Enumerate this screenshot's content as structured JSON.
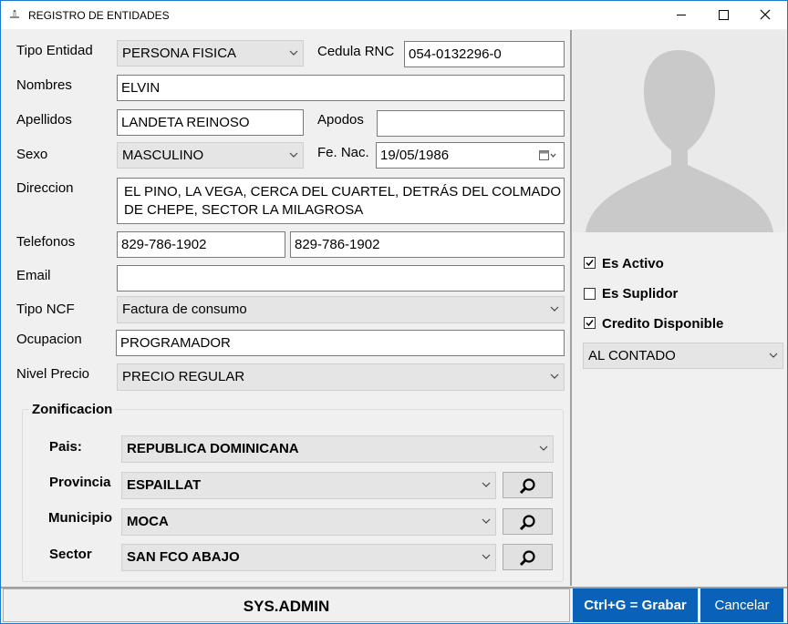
{
  "window": {
    "title": "REGISTRO DE ENTIDADES",
    "icons": {
      "app": "form-icon",
      "minimize": "minimize-icon",
      "maximize": "maximize-icon",
      "close": "close-icon"
    }
  },
  "form": {
    "tipo_entidad": {
      "label": "Tipo Entidad",
      "value": "PERSONA FISICA"
    },
    "cedula_rnc": {
      "label": "Cedula RNC",
      "value": "054-0132296-0"
    },
    "nombres": {
      "label": "Nombres",
      "value": "ELVIN"
    },
    "apellidos": {
      "label": "Apellidos",
      "value": "LANDETA REINOSO"
    },
    "apodos": {
      "label": "Apodos",
      "value": ""
    },
    "sexo": {
      "label": "Sexo",
      "value": "MASCULINO"
    },
    "fe_nac": {
      "label": "Fe. Nac.",
      "value": "19/05/1986"
    },
    "direccion": {
      "label": "Direccion",
      "line1": "EL PINO, LA VEGA, CERCA DEL CUARTEL, DETRÁS DEL COLMADO",
      "line2": "DE CHEPE, SECTOR LA MILAGROSA"
    },
    "telefonos": {
      "label": "Telefonos",
      "value1": "829-786-1902",
      "value2": "829-786-1902"
    },
    "email": {
      "label": "Email",
      "value": ""
    },
    "tipo_ncf": {
      "label": "Tipo NCF",
      "value": "Factura de consumo"
    },
    "ocupacion": {
      "label": "Ocupacion",
      "value": "PROGRAMADOR"
    },
    "nivel_precio": {
      "label": "Nivel Precio",
      "value": "PRECIO REGULAR"
    }
  },
  "zonificacion": {
    "title": "Zonificacion",
    "pais": {
      "label": "Pais:",
      "value": "REPUBLICA DOMINICANA"
    },
    "provincia": {
      "label": "Provincia",
      "value": "ESPAILLAT"
    },
    "municipio": {
      "label": "Municipio",
      "value": "MOCA"
    },
    "sector": {
      "label": "Sector",
      "value": "SAN FCO ABAJO"
    }
  },
  "sidebar": {
    "es_activo": {
      "label": "Es Activo",
      "checked": true
    },
    "es_suplidor": {
      "label": "Es Suplidor",
      "checked": false
    },
    "credito_disponible": {
      "label": "Credito Disponible",
      "checked": true
    },
    "credito_tipo": "AL CONTADO"
  },
  "footer": {
    "user": "SYS.ADMIN",
    "save_label": "Ctrl+G = Grabar",
    "cancel_label": "Cancelar"
  },
  "colors": {
    "accent": "#0a62b8",
    "window_border": "#1f78c9",
    "panel": "#f0f0f0"
  }
}
